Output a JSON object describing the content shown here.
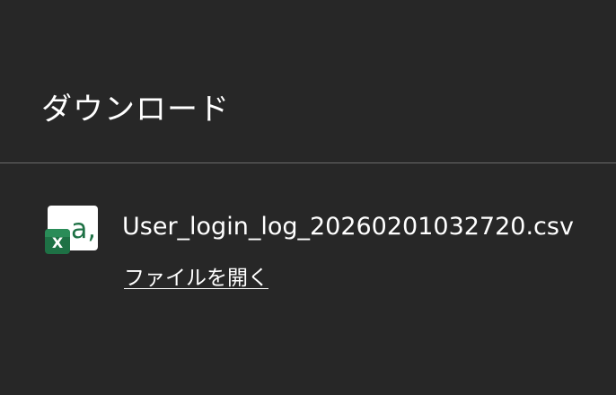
{
  "panel": {
    "title": "ダウンロード"
  },
  "download": {
    "file_name": "User_login_log_20260201032720.csv",
    "open_link_label": "ファイルを開く",
    "icon": "excel-csv-file-icon",
    "icon_badge_letter": "X",
    "icon_glyph": "a,"
  },
  "colors": {
    "background": "#272727",
    "divider": "#6b6b6b",
    "text": "#ffffff",
    "excel_green": "#1e7145"
  }
}
